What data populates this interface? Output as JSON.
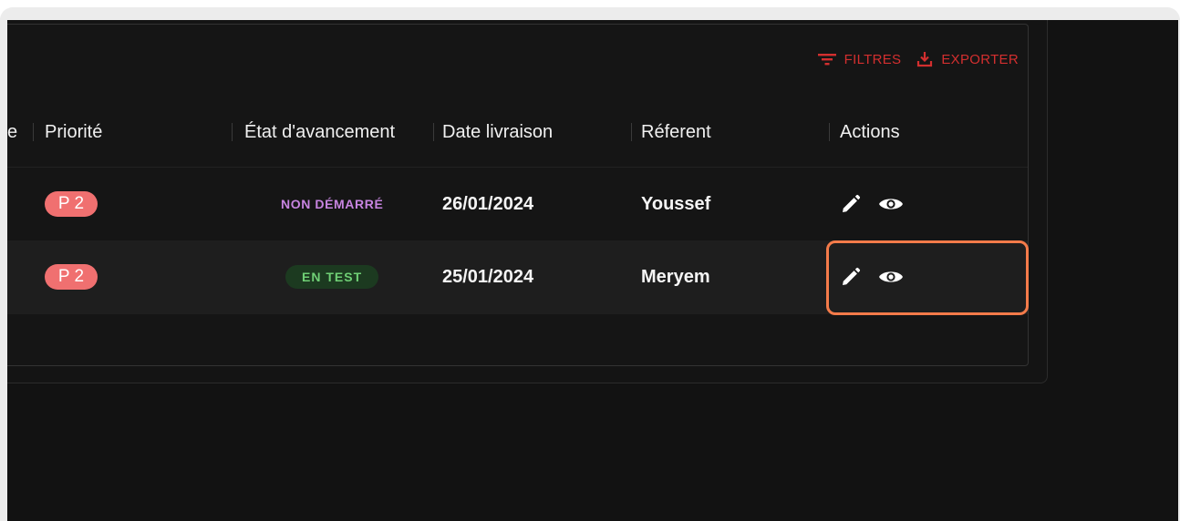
{
  "toolbar": {
    "filters_label": "FILTRES",
    "export_label": "EXPORTER",
    "accent_color": "#d32f2f"
  },
  "table": {
    "partial_col_label": "e",
    "columns": [
      "Priorité",
      "État d'avancement",
      "Date livraison",
      "Réferent",
      "Actions"
    ],
    "rows": [
      {
        "priority": "P 2",
        "status": "NON DÉMARRÉ",
        "status_style": "plain",
        "delivery_date": "26/01/2024",
        "referent": "Youssef",
        "actions": [
          "pencil-icon",
          "eye-icon"
        ]
      },
      {
        "priority": "P 2",
        "status": "EN TEST",
        "status_style": "chip",
        "delivery_date": "25/01/2024",
        "referent": "Meryem",
        "actions": [
          "pencil-icon",
          "eye-icon"
        ]
      }
    ]
  },
  "colors": {
    "priority_chip": "#f07070",
    "status_not_started": "#c784e0",
    "status_test_text": "#6fcf75",
    "status_test_bg": "#1c3a20",
    "highlight": "#f47b4a"
  }
}
